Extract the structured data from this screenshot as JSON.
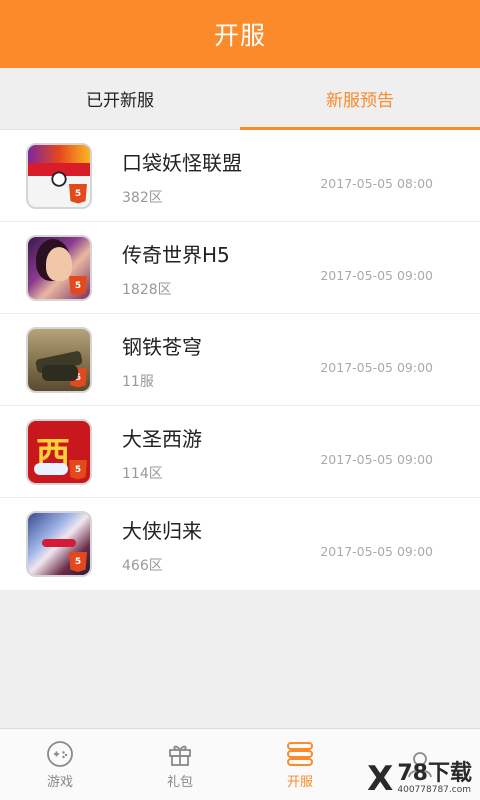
{
  "header": {
    "title": "开服"
  },
  "tabs": [
    {
      "label": "已开新服",
      "active": false
    },
    {
      "label": "新服预告",
      "active": true
    }
  ],
  "games": [
    {
      "name": "口袋妖怪联盟",
      "server": "382区",
      "time": "2017-05-05 08:00"
    },
    {
      "name": "传奇世界H5",
      "server": "1828区",
      "time": "2017-05-05 09:00"
    },
    {
      "name": "钢铁苍穹",
      "server": "11服",
      "time": "2017-05-05 09:00"
    },
    {
      "name": "大圣西游",
      "server": "114区",
      "time": "2017-05-05 09:00"
    },
    {
      "name": "大侠归来",
      "server": "466区",
      "time": "2017-05-05 09:00"
    }
  ],
  "icon_badge": "5",
  "icon_glyph_4": "西",
  "bottom_nav": [
    {
      "label": "游戏",
      "icon": "gamepad-icon",
      "active": false
    },
    {
      "label": "礼包",
      "icon": "gift-icon",
      "active": false
    },
    {
      "label": "开服",
      "icon": "server-list-icon",
      "active": true
    },
    {
      "label": "",
      "icon": "user-icon",
      "active": false
    }
  ],
  "watermark": {
    "brand": "78下载",
    "url": "400778787.com"
  },
  "colors": {
    "accent": "#fb8a2b",
    "background": "#efefef"
  }
}
